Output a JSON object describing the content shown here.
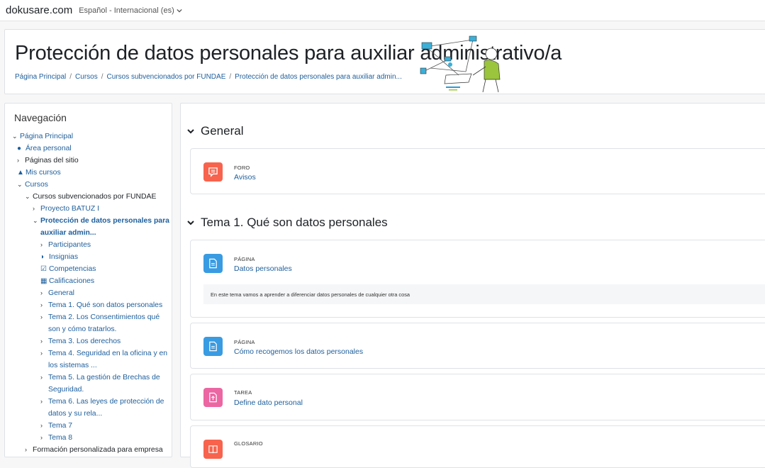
{
  "topbar": {
    "site": "dokusare.com",
    "language": "Español - Internacional (es)"
  },
  "header": {
    "title": "Protección de datos personales para auxiliar administrativo/a",
    "breadcrumb": [
      "Página Principal",
      "Cursos",
      "Cursos subvencionados por FUNDAE",
      "Protección de datos personales para auxiliar admin..."
    ]
  },
  "nav": {
    "title": "Navegación",
    "items": [
      {
        "label": "Página Principal"
      },
      {
        "label": "Área personal"
      },
      {
        "label": "Páginas del sitio"
      },
      {
        "label": "Mis cursos"
      },
      {
        "label": "Cursos"
      },
      {
        "label": "Cursos subvencionados por FUNDAE"
      },
      {
        "label": "Proyecto BATUZ I"
      },
      {
        "label": "Protección de datos personales para auxiliar admin..."
      },
      {
        "label": "Participantes"
      },
      {
        "label": "Insignias"
      },
      {
        "label": "Competencias"
      },
      {
        "label": "Calificaciones"
      },
      {
        "label": "General"
      },
      {
        "label": "Tema 1. Qué son datos personales"
      },
      {
        "label": "Tema 2. Los Consentimientos qué son y cómo tratarlos."
      },
      {
        "label": "Tema 3. Los derechos"
      },
      {
        "label": "Tema 4. Seguridad en la oficina y en los sistemas ..."
      },
      {
        "label": "Tema 5. La gestión de Brechas de Seguridad."
      },
      {
        "label": "Tema 6. Las leyes de protección de datos y su rela..."
      },
      {
        "label": "Tema 7"
      },
      {
        "label": "Tema 8"
      },
      {
        "label": "Formación personalizada para empresa"
      }
    ]
  },
  "main": {
    "sections": [
      {
        "title": "General"
      },
      {
        "title": "Tema 1. Qué son datos personales"
      }
    ],
    "activities": [
      {
        "type": "FORO",
        "name": "Avisos",
        "color": "#f7634d",
        "icon": "forum-icon"
      },
      {
        "type": "PÁGINA",
        "name": "Datos personales",
        "color": "#399be2",
        "icon": "page-icon",
        "description": "En este tema vamos a aprender a diferenciar datos personales de cualquier otra cosa"
      },
      {
        "type": "PÁGINA",
        "name": "Cómo recogemos los datos personales",
        "color": "#399be2",
        "icon": "page-icon"
      },
      {
        "type": "TAREA",
        "name": "Define dato personal",
        "color": "#eb66a2",
        "icon": "assignment-icon"
      },
      {
        "type": "GLOSARIO",
        "name": "",
        "color": "#f7634d",
        "icon": "glossary-icon"
      }
    ]
  }
}
